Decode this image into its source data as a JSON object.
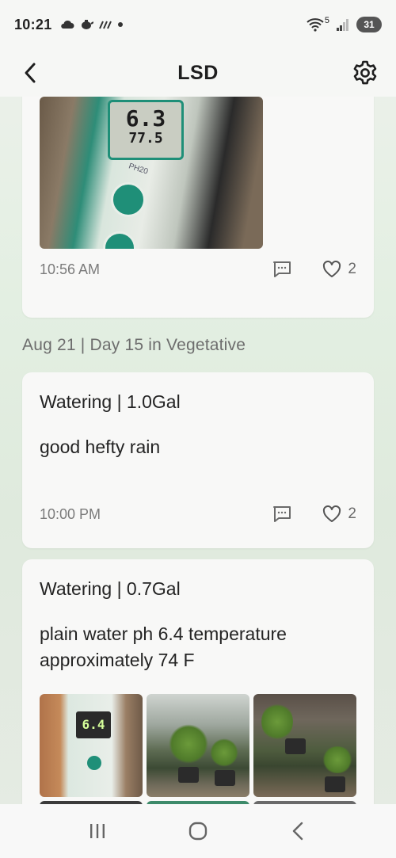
{
  "status_bar": {
    "time": "10:21",
    "left_icons": [
      "cloud-icon",
      "teapot-icon",
      "data-icon",
      "dot-icon"
    ],
    "wifi_label": "5",
    "battery": "31"
  },
  "header": {
    "title": "LSD",
    "back_icon": "chevron-left-icon",
    "settings_icon": "gear-icon"
  },
  "feed": {
    "card1": {
      "photo": {
        "lcd_value": "6.3",
        "lcd_temp": "77.5",
        "brand": "PH20"
      },
      "time": "10:56 AM",
      "likes": "2"
    },
    "date_header": "Aug 21 | Day 15 in Vegetative",
    "card2": {
      "title": "Watering | 1.0Gal",
      "note": "good hefty rain",
      "time": "10:00 PM",
      "likes": "2"
    },
    "card3": {
      "title": "Watering | 0.7Gal",
      "note": "plain water ph 6.4 temperature approximately 74 F",
      "thumb_lcd": "6.4"
    }
  },
  "nav": {
    "recents_icon": "recents-icon",
    "home_icon": "home-icon",
    "back_icon": "back-icon"
  },
  "colors": {
    "background_gradient": "#dfeadd",
    "card": "#f8f8f7",
    "meta_text": "#7b7b7b",
    "accent_green": "#1f8f78"
  }
}
